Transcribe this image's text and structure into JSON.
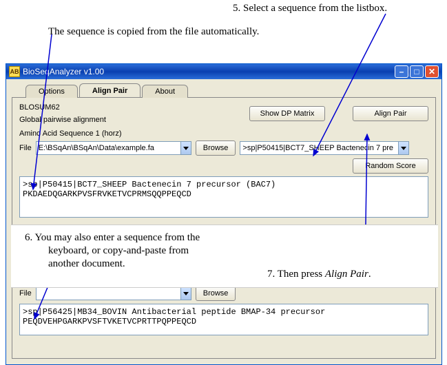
{
  "annotations": {
    "a5": "5.  Select a sequence from the listbox.",
    "aAuto": "The sequence is copied from the file automatically.",
    "a6a": "6.  You may also enter a sequence from the",
    "a6b": "keyboard, or copy-and-paste from",
    "a6c": "another document.",
    "a7pre": "7.  Then press ",
    "a7em": "Align Pair",
    "a7post": "."
  },
  "window": {
    "title": "BioSeqAnalyzer  v1.00",
    "iconGlyph": "AB"
  },
  "tabs": {
    "options": "Options",
    "alignPair": "Align Pair",
    "about": "About"
  },
  "panel": {
    "matrix": "BLOSUM62",
    "alignmentType": "Global pairwise alignment",
    "seq1Label": "Amino Acid Sequence 1 (horz)",
    "fileLabel": "File",
    "filePath1": "E:\\BSqAn\\BSqAn\\Data\\example.fa",
    "browseLabel": "Browse",
    "seqDropdown": ">sp|P50415|BCT7_SHEEP Bactenecin 7 pre",
    "randomScoreLabel": "Random Score",
    "showDpLabel": "Show DP Matrix",
    "alignPairLabel": "Align Pair",
    "seq1Text": ">sp|P50415|BCT7_SHEEP Bactenecin 7 precursor (BAC7)\nPKDAEDQGARKPVSFRVKETVCPRMSQQPPEQCD",
    "filePath2": "",
    "seq2Text": ">sp|P56425|MB34_BOVIN Antibacterial peptide BMAP-34 precursor\nPEQDVEHPGARKPVSFTVKETVCPRTTPQPPEQCD"
  }
}
